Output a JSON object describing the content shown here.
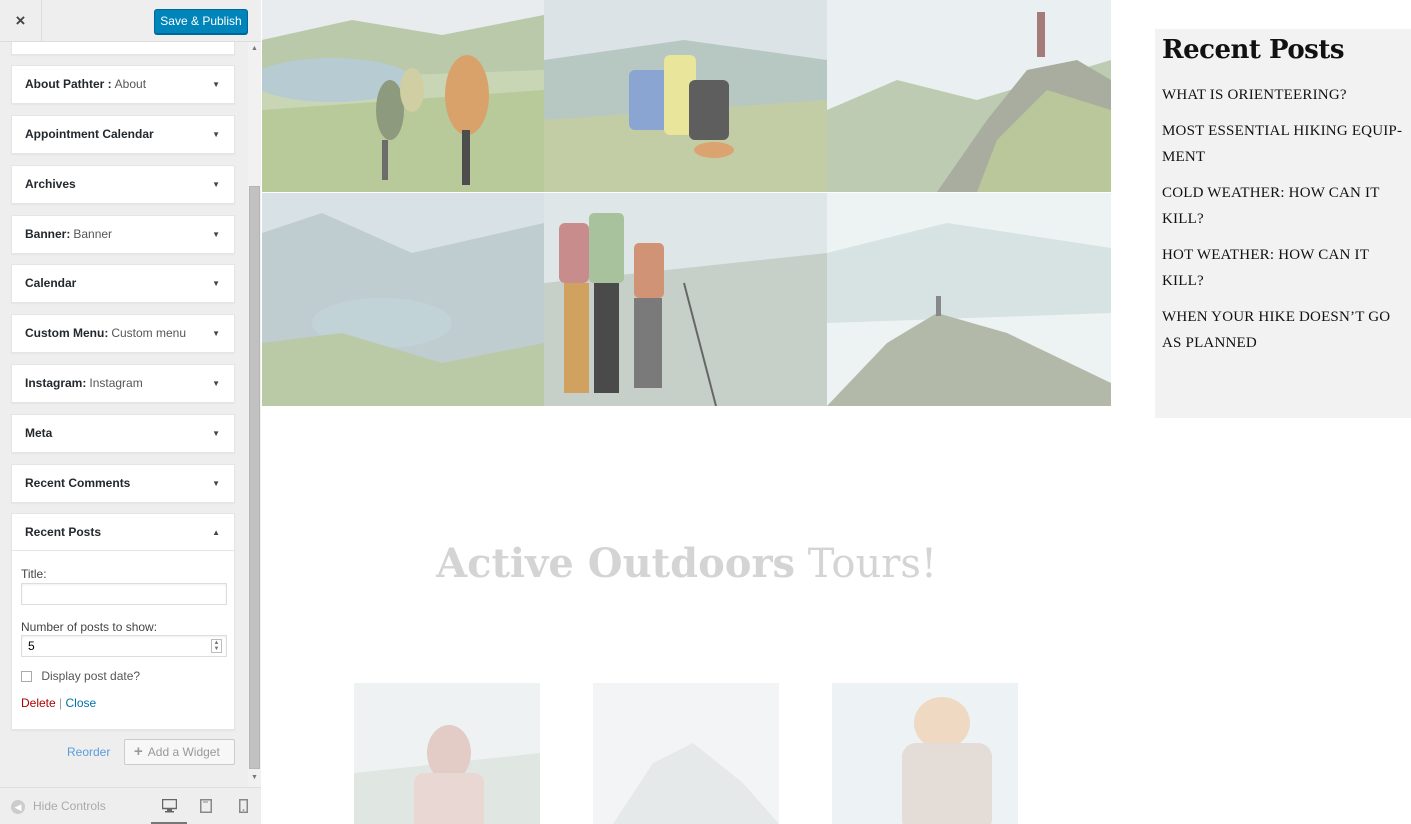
{
  "header": {
    "close_glyph": "×",
    "save_label": "Save & Publish"
  },
  "widgets": [
    {
      "name": "About Pathter :",
      "subtitle": "About"
    },
    {
      "name": "Appointment Calendar",
      "subtitle": ""
    },
    {
      "name": "Archives",
      "subtitle": ""
    },
    {
      "name": "Banner:",
      "subtitle": "Banner"
    },
    {
      "name": "Calendar",
      "subtitle": ""
    },
    {
      "name": "Custom Menu:",
      "subtitle": "Custom menu"
    },
    {
      "name": "Instagram:",
      "subtitle": "Instagram"
    },
    {
      "name": "Meta",
      "subtitle": ""
    },
    {
      "name": "Recent Comments",
      "subtitle": ""
    }
  ],
  "open_widget": {
    "name": "Recent Posts",
    "title_label": "Title:",
    "title_value": "",
    "number_label": "Number of posts to show:",
    "number_value": "5",
    "display_date_label": "Display post date?",
    "display_date_checked": false,
    "delete_label": "Delete",
    "separator": "|",
    "close_label": "Close"
  },
  "actions": {
    "reorder_label": "Reorder",
    "add_widget_label": "Add a Widget"
  },
  "footer": {
    "hide_controls_label": "Hide Controls"
  },
  "preview": {
    "heading_bold": "Active Outdoors",
    "heading_rest": " Tours!",
    "sidebar_title": "Recent Posts",
    "posts": [
      "WHAT IS ORIENTEERING?",
      "MOST ESSENTIAL HIKING EQUIP-MENT",
      "COLD WEATHER: HOW CAN IT KILL?",
      "HOT WEATHER: HOW CAN IT KILL?",
      "WHEN YOUR HIKE DOESN’T GO AS PLANNED"
    ]
  },
  "colors": {
    "primary_button": "#0085ba",
    "delete_link": "#aa0000",
    "close_link": "#0073aa"
  },
  "icons": [
    "close-icon",
    "caret-down-icon",
    "caret-up-icon",
    "plus-icon",
    "hide-controls-icon",
    "desktop-icon",
    "tablet-icon",
    "mobile-icon"
  ]
}
